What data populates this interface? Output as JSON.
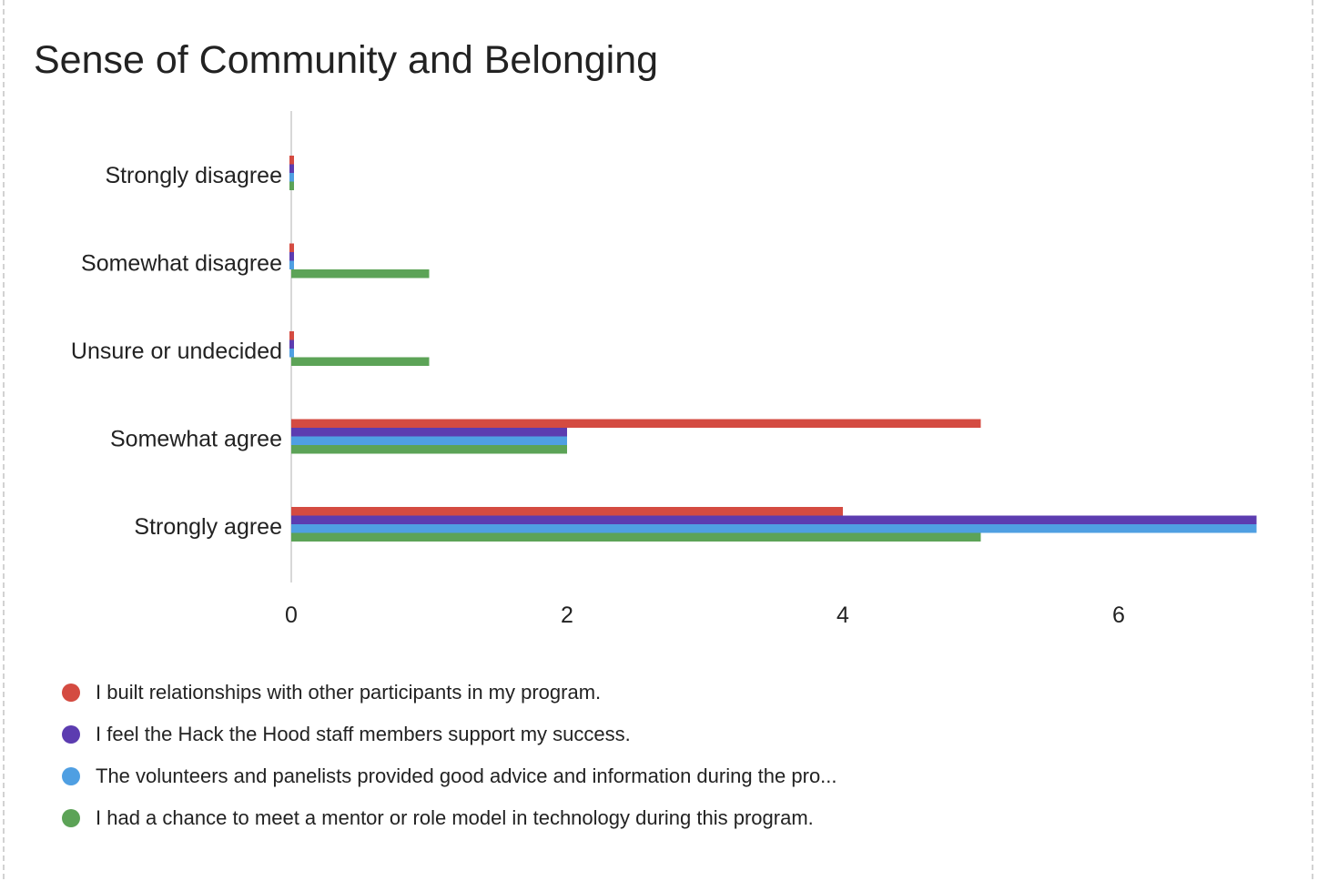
{
  "chart_data": {
    "type": "bar",
    "orientation": "horizontal",
    "title": "Sense of Community and Belonging",
    "categories": [
      "Strongly disagree",
      "Somewhat disagree",
      "Unsure or undecided",
      "Somewhat agree",
      "Strongly agree"
    ],
    "series": [
      {
        "name": "I built relationships with other participants in my program.",
        "color": "#d44b41",
        "values": [
          0,
          0,
          0,
          5,
          4
        ]
      },
      {
        "name": "I feel the Hack the Hood staff members support my success.",
        "color": "#5c3cb0",
        "values": [
          0,
          0,
          0,
          2,
          7
        ]
      },
      {
        "name": "The volunteers and panelists provided good advice and information during the pro...",
        "color": "#4f9fe2",
        "values": [
          0,
          0,
          0,
          2,
          7
        ]
      },
      {
        "name": "I had a chance to meet a mentor or role model in technology during this program.",
        "color": "#5ca357",
        "values": [
          0,
          1,
          1,
          2,
          5
        ]
      }
    ],
    "xticks": [
      "0",
      "2",
      "4",
      "6"
    ],
    "xlim": [
      0,
      7
    ],
    "legend_position": "bottom",
    "grid": false
  }
}
